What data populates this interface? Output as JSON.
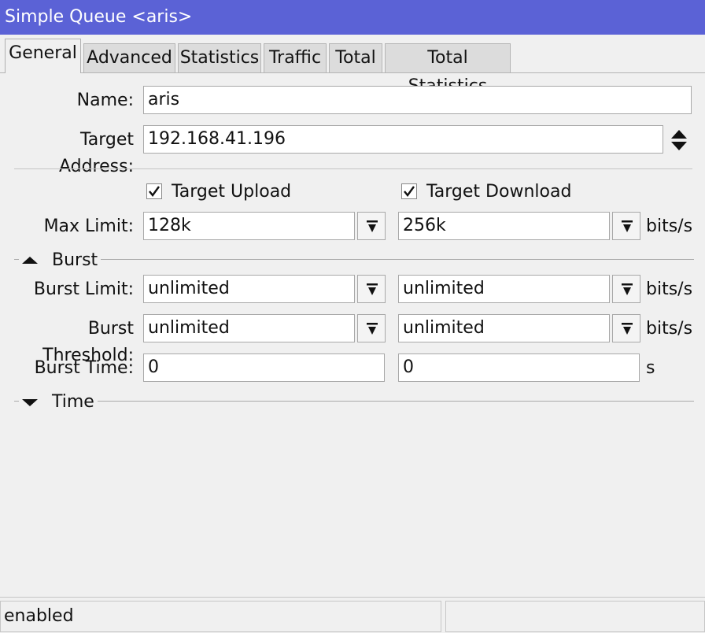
{
  "window": {
    "title": "Simple Queue <aris>"
  },
  "tabs": [
    {
      "label": "General",
      "active": true
    },
    {
      "label": "Advanced",
      "active": false
    },
    {
      "label": "Statistics",
      "active": false
    },
    {
      "label": "Traffic",
      "active": false
    },
    {
      "label": "Total",
      "active": false
    },
    {
      "label": "Total Statistics",
      "active": false
    }
  ],
  "form": {
    "name": {
      "label": "Name:",
      "value": "aris"
    },
    "target_address": {
      "label": "Target Address:",
      "value": "192.168.41.196"
    },
    "target_upload": {
      "label": "Target Upload",
      "checked": true
    },
    "target_download": {
      "label": "Target Download",
      "checked": true
    },
    "max_limit": {
      "label": "Max Limit:",
      "upload": "128k",
      "download": "256k",
      "unit": "bits/s"
    },
    "burst_section": {
      "label": "Burst",
      "expanded": true
    },
    "burst_limit": {
      "label": "Burst Limit:",
      "upload": "unlimited",
      "download": "unlimited",
      "unit": "bits/s"
    },
    "burst_threshold": {
      "label": "Burst Threshold:",
      "upload": "unlimited",
      "download": "unlimited",
      "unit": "bits/s"
    },
    "burst_time": {
      "label": "Burst Time:",
      "upload": "0",
      "download": "0",
      "unit": "s"
    },
    "time_section": {
      "label": "Time",
      "expanded": false
    }
  },
  "status": {
    "text": "enabled",
    "right": ""
  },
  "colors": {
    "titlebar": "#5b62d6",
    "background": "#f0f0f0"
  }
}
